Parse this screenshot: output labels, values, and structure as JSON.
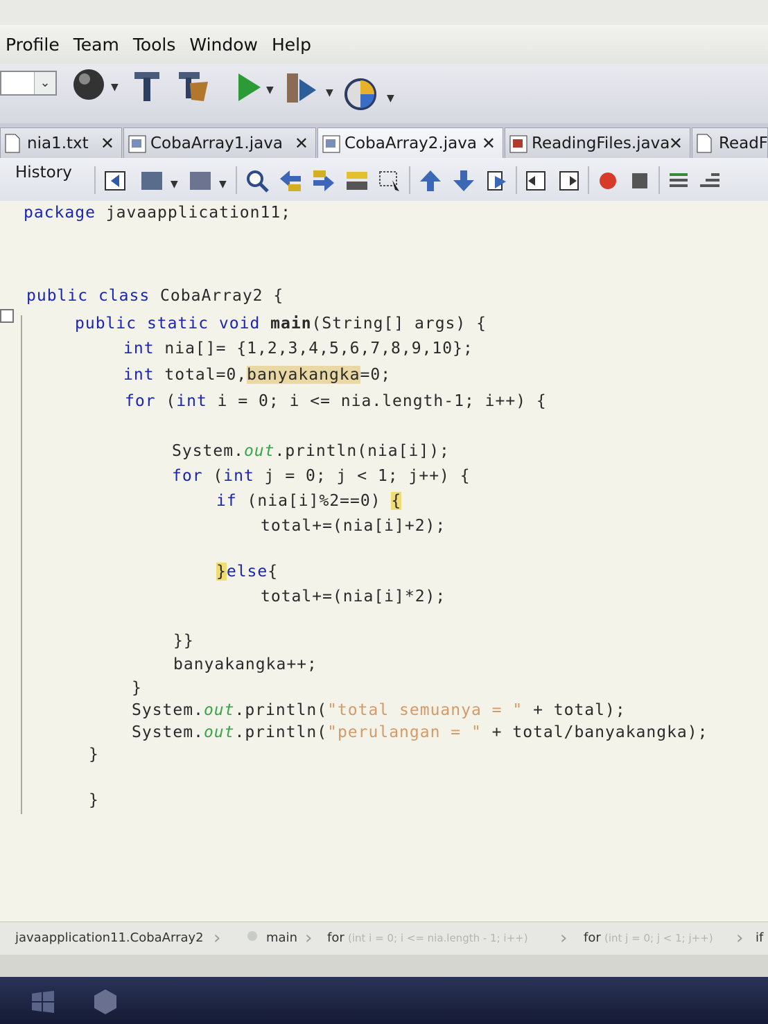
{
  "menu": {
    "items": [
      "Profile",
      "Team",
      "Tools",
      "Window",
      "Help"
    ]
  },
  "tabs": [
    {
      "label": "nia1.txt",
      "close": "✕"
    },
    {
      "label": "CobaArray1.java",
      "close": "✕"
    },
    {
      "label": "CobaArray2.java",
      "close": "✕",
      "active": true
    },
    {
      "label": "ReadingFiles.java",
      "close": "✕"
    },
    {
      "label": "ReadFil"
    }
  ],
  "editor_toolbar": {
    "history_label": "History"
  },
  "code": {
    "line1": [
      "package",
      " javaapplication11;"
    ],
    "line2": [
      "public",
      " ",
      "class",
      " CobaArray2 {"
    ],
    "line3": [
      "public",
      " ",
      "static",
      " ",
      "void",
      " ",
      "main",
      "(String[] args) {"
    ],
    "line4": [
      "int",
      " nia[]= {1,2,3,4,5,6,7,8,9,10};"
    ],
    "line5": [
      "int",
      " total=0,",
      "banyakangka",
      "=0;"
    ],
    "line6": [
      "for",
      " (",
      "int",
      " i = 0; i <= nia.length-1; i++) {"
    ],
    "line7": [
      "System.",
      "out",
      ".println(nia[i]);"
    ],
    "line8": [
      "for",
      " (",
      "int",
      " j = 0; j < 1; j++) {"
    ],
    "line9": [
      "if",
      " (nia[i]%2==0) ",
      "{"
    ],
    "line10": "total+=(nia[i]+2);",
    "line11": [
      "}",
      "else",
      "{"
    ],
    "line12": "total+=(nia[i]*2);",
    "line13": "}}",
    "line14": "banyakangka++;",
    "line15": "}",
    "line16": [
      "System.",
      "out",
      ".println(",
      "\"total semuanya = \"",
      " + total);"
    ],
    "line17": [
      "System.",
      "out",
      ".println(",
      "\"perulangan = \"",
      " + total/banyakangka);"
    ],
    "line18": "}",
    "line19": "}"
  },
  "breadcrumb": {
    "items": [
      "javaapplication11.CobaArray2",
      "main",
      "for",
      "(int i = 0; i <= nia.length - 1; i++)",
      "for",
      "(int j = 0; j < 1; j++)",
      "if"
    ]
  },
  "colors": {
    "keyword": "#1c26b0",
    "field": "#39a34d",
    "string": "#d49a68",
    "highlight": "#f0dc75"
  }
}
